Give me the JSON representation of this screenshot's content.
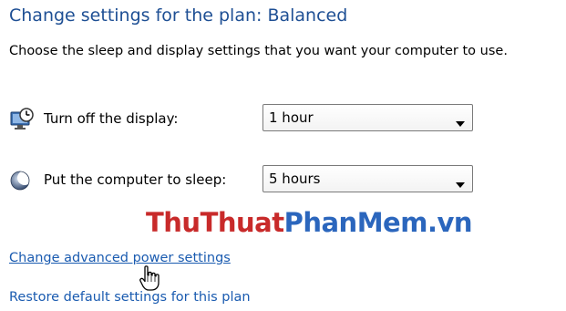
{
  "header": {
    "title": "Change settings for the plan: Balanced",
    "subtitle": "Choose the sleep and display settings that you want your computer to use."
  },
  "settings": {
    "display": {
      "icon": "monitor-clock-icon",
      "label": "Turn off the display:",
      "value": "1 hour"
    },
    "sleep": {
      "icon": "moon-sleep-icon",
      "label": "Put the computer to sleep:",
      "value": "5 hours"
    }
  },
  "watermark": {
    "part1": "ThuThuat",
    "part2": "PhanMem",
    "part3": ".vn",
    "colors": {
      "red": "#c82a2a",
      "blue": "#2b66bd"
    }
  },
  "links": {
    "advanced": "Change advanced power settings",
    "restore": "Restore default settings for this plan"
  },
  "colors": {
    "title": "#1e4f94",
    "link": "#1a5bb0"
  },
  "cursor": {
    "icon": "hand-pointer-icon"
  }
}
